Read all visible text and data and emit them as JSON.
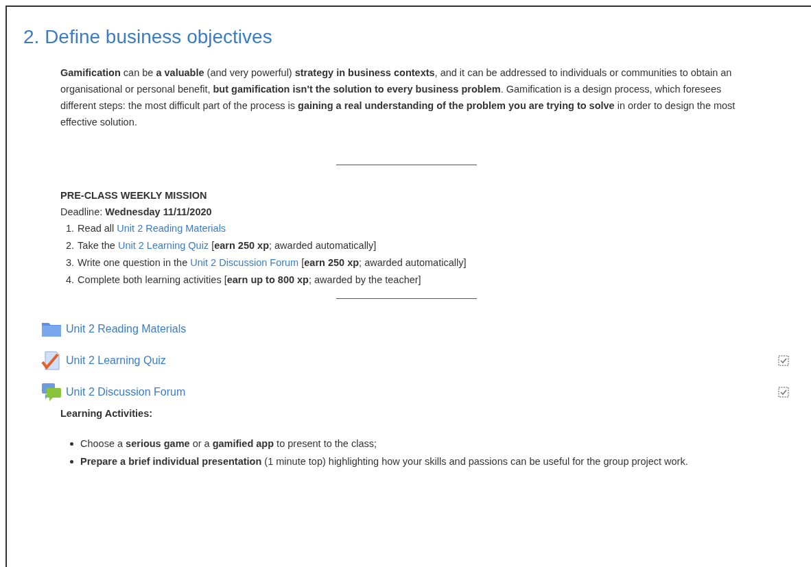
{
  "section": {
    "title": "2. Define business objectives"
  },
  "intro": "**Gamification** can be **a valuable** (and very powerful) **strategy in business contexts**, and it can be addressed to individuals or communities to obtain an organisational or personal benefit, **but gamification isn't the solution to every business problem**. Gamification is a design process, which foresees different steps: the most difficult part of the process is **gaining a real understanding of the problem you are trying to solve** in order to design the most effective solution.",
  "mission": {
    "heading": "PRE-CLASS WEEKLY MISSION",
    "deadline": "Deadline: **Wednesday 11/11/2020**",
    "steps": [
      {
        "number": "1.",
        "parts": [
          {
            "kind": "text",
            "text": "Read all "
          },
          {
            "kind": "link",
            "text": "Unit 2 Reading Materials"
          }
        ]
      },
      {
        "number": "2.",
        "parts": [
          {
            "kind": "text",
            "text": "Take the "
          },
          {
            "kind": "link",
            "text": "Unit 2 Learning Quiz"
          },
          {
            "kind": "text",
            "text": " [**earn 250 xp**; awarded automatically]"
          }
        ]
      },
      {
        "number": "3.",
        "parts": [
          {
            "kind": "text",
            "text": "Write one question in the "
          },
          {
            "kind": "link",
            "text": "Unit 2 Discussion Forum"
          },
          {
            "kind": "text",
            "text": " [**earn 250 xp**; awarded automatically]"
          }
        ]
      },
      {
        "number": "4.",
        "parts": [
          {
            "kind": "text",
            "text": "Complete both learning activities [**earn up to 800 xp**; awarded by the teacher]"
          }
        ]
      }
    ]
  },
  "activities": [
    {
      "kind": "folder",
      "label": "Unit 2 Reading Materials"
    },
    {
      "kind": "quiz",
      "label": "Unit 2 Learning Quiz",
      "completion": {
        "checked": true
      }
    },
    {
      "kind": "forum",
      "label": "Unit 2 Discussion Forum",
      "completion": {
        "checked": true
      }
    }
  ],
  "learning_activities": {
    "heading": "Learning Activities:",
    "items": [
      "Choose a **serious game** or a **gamified app** to present to the class;",
      "**Prepare a brief individual presentation** (1 minute top) highlighting how your skills and passions can be useful for the group project work."
    ]
  }
}
